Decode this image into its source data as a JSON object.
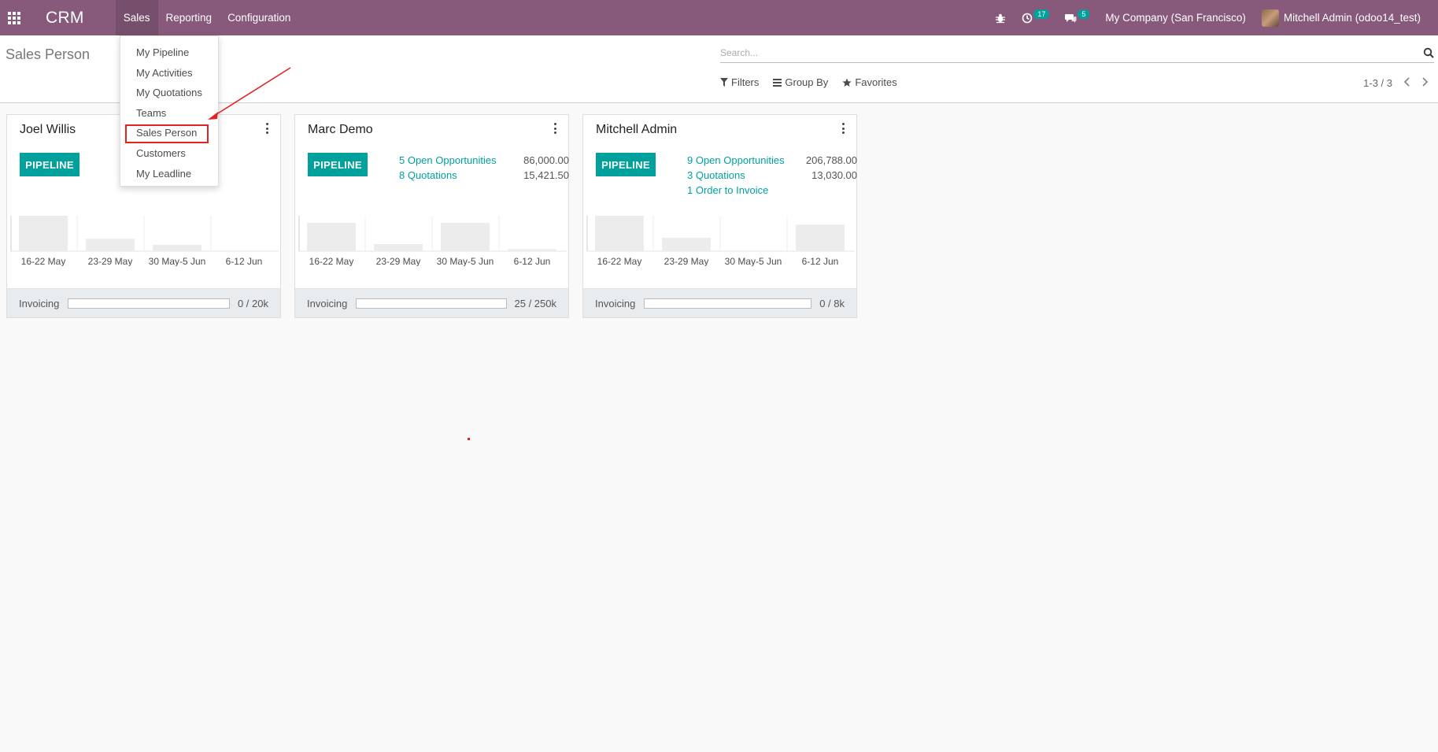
{
  "navbar": {
    "brand": "CRM",
    "menu": [
      "Sales",
      "Reporting",
      "Configuration"
    ],
    "activities_count": "17",
    "messages_count": "5",
    "company": "My Company (San Francisco)",
    "user": "Mitchell Admin (odoo14_test)"
  },
  "control": {
    "title": "Sales Person",
    "search_placeholder": "Search...",
    "filters": "Filters",
    "group_by": "Group By",
    "favorites": "Favorites",
    "pager": "1-3 / 3"
  },
  "dropdown": {
    "items": [
      "My Pipeline",
      "My Activities",
      "My Quotations",
      "Teams",
      "Sales Person",
      "Customers",
      "My Leadline"
    ]
  },
  "cards": [
    {
      "name": "Joel Willis",
      "pipeline_label": "PIPELINE",
      "stats": [],
      "graph": {
        "labels": [
          "16-22 May",
          "23-29 May",
          "30 May-5 Jun",
          "6-12 Jun"
        ],
        "values": [
          1.0,
          0.35,
          0.18,
          0
        ]
      },
      "invoicing": {
        "label": "Invoicing",
        "value": "0 / 20k",
        "progress": 0
      }
    },
    {
      "name": "Marc Demo",
      "pipeline_label": "PIPELINE",
      "stats": [
        {
          "label": "5 Open Opportunities",
          "value": "86,000.00"
        },
        {
          "label": "8 Quotations",
          "value": "15,421.50"
        }
      ],
      "graph": {
        "labels": [
          "16-22 May",
          "23-29 May",
          "30 May-5 Jun",
          "6-12 Jun"
        ],
        "values": [
          0.8,
          0.2,
          0.8,
          0.06
        ]
      },
      "invoicing": {
        "label": "Invoicing",
        "value": "25 / 250k",
        "progress": 0.0001
      }
    },
    {
      "name": "Mitchell Admin",
      "pipeline_label": "PIPELINE",
      "stats": [
        {
          "label": "9 Open Opportunities",
          "value": "206,788.00"
        },
        {
          "label": "3 Quotations",
          "value": "13,030.00"
        },
        {
          "label": "1 Order to Invoice",
          "value": ""
        }
      ],
      "graph": {
        "labels": [
          "16-22 May",
          "23-29 May",
          "30 May-5 Jun",
          "6-12 Jun"
        ],
        "values": [
          1.0,
          0.38,
          0,
          0.75
        ]
      },
      "invoicing": {
        "label": "Invoicing",
        "value": "0 / 8k",
        "progress": 0
      }
    }
  ],
  "colors": {
    "navbar": "#875a7b",
    "accent": "#00a09d",
    "annotation": "#e02424"
  }
}
